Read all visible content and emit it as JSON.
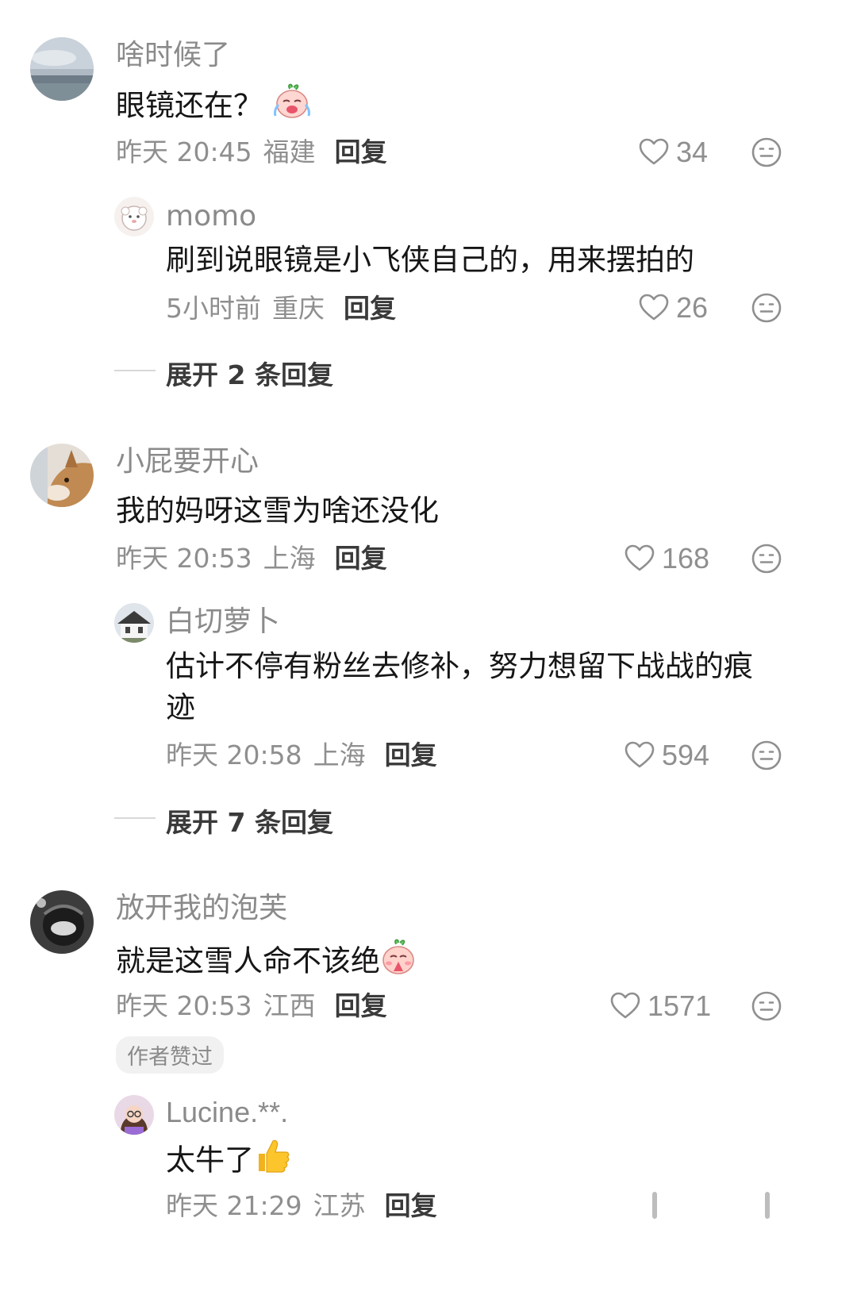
{
  "comments": [
    {
      "user": "啥时候了",
      "text": "眼镜还在？",
      "time": "昨天 20:45",
      "location": "福建",
      "reply": "回复",
      "likes": "34",
      "replies": [
        {
          "user": "momo",
          "text": "刷到说眼镜是小飞侠自己的，用来摆拍的",
          "time": "5小时前",
          "location": "重庆",
          "reply": "回复",
          "likes": "26"
        }
      ],
      "expand": "展开 2 条回复"
    },
    {
      "user": "小屁要开心",
      "text": "我的妈呀这雪为啥还没化",
      "time": "昨天 20:53",
      "location": "上海",
      "reply": "回复",
      "likes": "168",
      "replies": [
        {
          "user": "白切萝卜",
          "text_line1": "估计不停有粉丝去修补，努力想留下战战的痕",
          "text_line2": "迹",
          "time": "昨天 20:58",
          "location": "上海",
          "reply": "回复",
          "likes": "594"
        }
      ],
      "expand": "展开 7 条回复"
    },
    {
      "user": "放开我的泡芙",
      "text": "就是这雪人命不该绝",
      "time": "昨天 20:53",
      "location": "江西",
      "reply": "回复",
      "likes": "1571",
      "badge": "作者赞过",
      "replies": [
        {
          "user": "Lucine.**.",
          "text": "太牛了",
          "time": "昨天 21:29",
          "location": "江苏",
          "reply": "回复"
        }
      ]
    }
  ],
  "icons": {
    "like": "heart-outline-icon",
    "dislike": "neutral-face-icon",
    "emoji_cry": "crying-peach-emoji",
    "emoji_pray": "praying-peach-emoji",
    "emoji_thumb": "thumbs-up-emoji"
  },
  "colors": {
    "name": "#8a8a8a",
    "meta": "#8f8f8f",
    "reply_button": "#3a3a3a",
    "text": "#161616"
  }
}
